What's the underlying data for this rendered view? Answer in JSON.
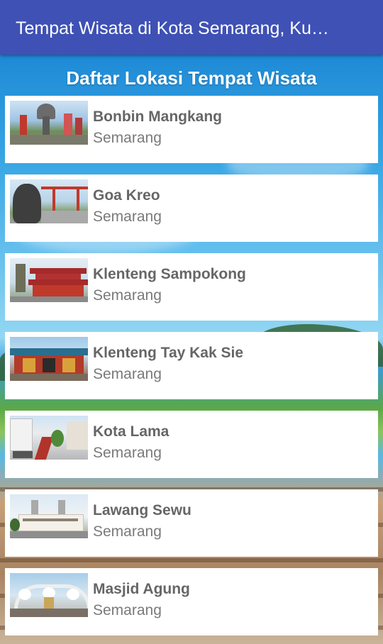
{
  "app": {
    "title": "Tempat Wisata di Kota Semarang, Ku…"
  },
  "list": {
    "heading": "Daftar Lokasi Tempat Wisata",
    "items": [
      {
        "name": "Bonbin Mangkang",
        "city": "Semarang"
      },
      {
        "name": "Goa Kreo",
        "city": "Semarang"
      },
      {
        "name": "Klenteng Sampokong",
        "city": "Semarang"
      },
      {
        "name": "Klenteng Tay Kak Sie",
        "city": "Semarang"
      },
      {
        "name": "Kota Lama",
        "city": "Semarang"
      },
      {
        "name": "Lawang Sewu",
        "city": "Semarang"
      },
      {
        "name": "Masjid Agung",
        "city": "Semarang"
      }
    ]
  },
  "colors": {
    "appbar": "#3f51b5",
    "card": "#ffffff",
    "item_text": "#666666"
  }
}
